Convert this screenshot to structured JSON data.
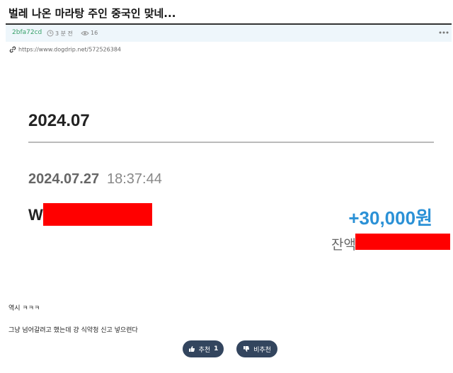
{
  "post": {
    "title": "벌레 나온 마라탕 주인 중국인 맞네...",
    "author": "2bfa72cd",
    "time": "3 분 전",
    "views": "16",
    "url": "https://www.dogdrip.net/572526384",
    "body_lines": [
      "역시 ㅋㅋㅋ",
      "그냥 넘어갈려고 했는데 걍 식약청 신고 넣으련다"
    ]
  },
  "bank_screenshot": {
    "month": "2024.07",
    "date": "2024.07.27",
    "time": "18:37:44",
    "name_prefix": "W",
    "amount": "+30,000원",
    "balance_label": "잔액",
    "colors": {
      "amount": "#2b91d6",
      "redaction": "#ff0000"
    }
  },
  "votes": {
    "up_label": "추천",
    "up_count": "1",
    "down_label": "비추천"
  },
  "icons": [
    "clock-icon",
    "eye-icon",
    "more-dots-icon",
    "link-icon",
    "thumbs-up-icon",
    "thumbs-down-icon"
  ]
}
